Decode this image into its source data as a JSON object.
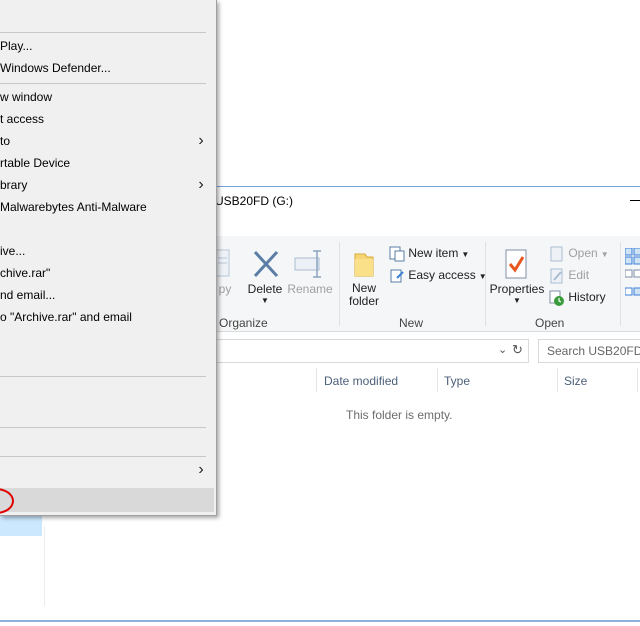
{
  "window": {
    "title": "USB20FD (G:)"
  },
  "context_menu": {
    "items": [
      {
        "id": "play",
        "label": "Play...",
        "submenu": false
      },
      {
        "id": "defender",
        "label": "Windows Defender...",
        "submenu": false
      },
      {
        "id": "new-window",
        "label": "w window",
        "submenu": false
      },
      {
        "id": "quick-access",
        "label": "t access",
        "submenu": false
      },
      {
        "id": "send-to",
        "label": "to",
        "submenu": true
      },
      {
        "id": "portable-device",
        "label": "rtable Device",
        "submenu": false
      },
      {
        "id": "library",
        "label": "brary",
        "submenu": true
      },
      {
        "id": "malwarebytes",
        "label": "Malwarebytes Anti-Malware",
        "submenu": false
      },
      {
        "id": "add-archive",
        "label": "ive...",
        "submenu": false
      },
      {
        "id": "add-archive-rar",
        "label": "chive.rar\"",
        "submenu": false
      },
      {
        "id": "compress-email",
        "label": "nd email...",
        "submenu": false
      },
      {
        "id": "compress-rar-email",
        "label": "o \"Archive.rar\" and email",
        "submenu": false
      },
      {
        "id": "more-submenu",
        "label": "",
        "submenu": true
      }
    ]
  },
  "ribbon": {
    "clipboard": {
      "copy_label": "py"
    },
    "organize": {
      "label": "Organize",
      "delete_label": "Delete",
      "rename_label": "Rename"
    },
    "new": {
      "label": "New",
      "new_folder_line1": "New",
      "new_folder_line2": "folder",
      "new_item_label": "New item",
      "easy_access_label": "Easy access"
    },
    "open": {
      "label": "Open",
      "properties_label": "Properties",
      "open_label": "Open",
      "edit_label": "Edit",
      "history_label": "History"
    }
  },
  "search": {
    "placeholder": "Search USB20FD ("
  },
  "file_list": {
    "columns": [
      "Date modified",
      "Type",
      "Size"
    ],
    "empty_message": "This folder is empty."
  },
  "colors": {
    "accent": "#3c7fd6",
    "highlight_circle": "#e00000",
    "menu_bg": "#f0f0f0"
  }
}
